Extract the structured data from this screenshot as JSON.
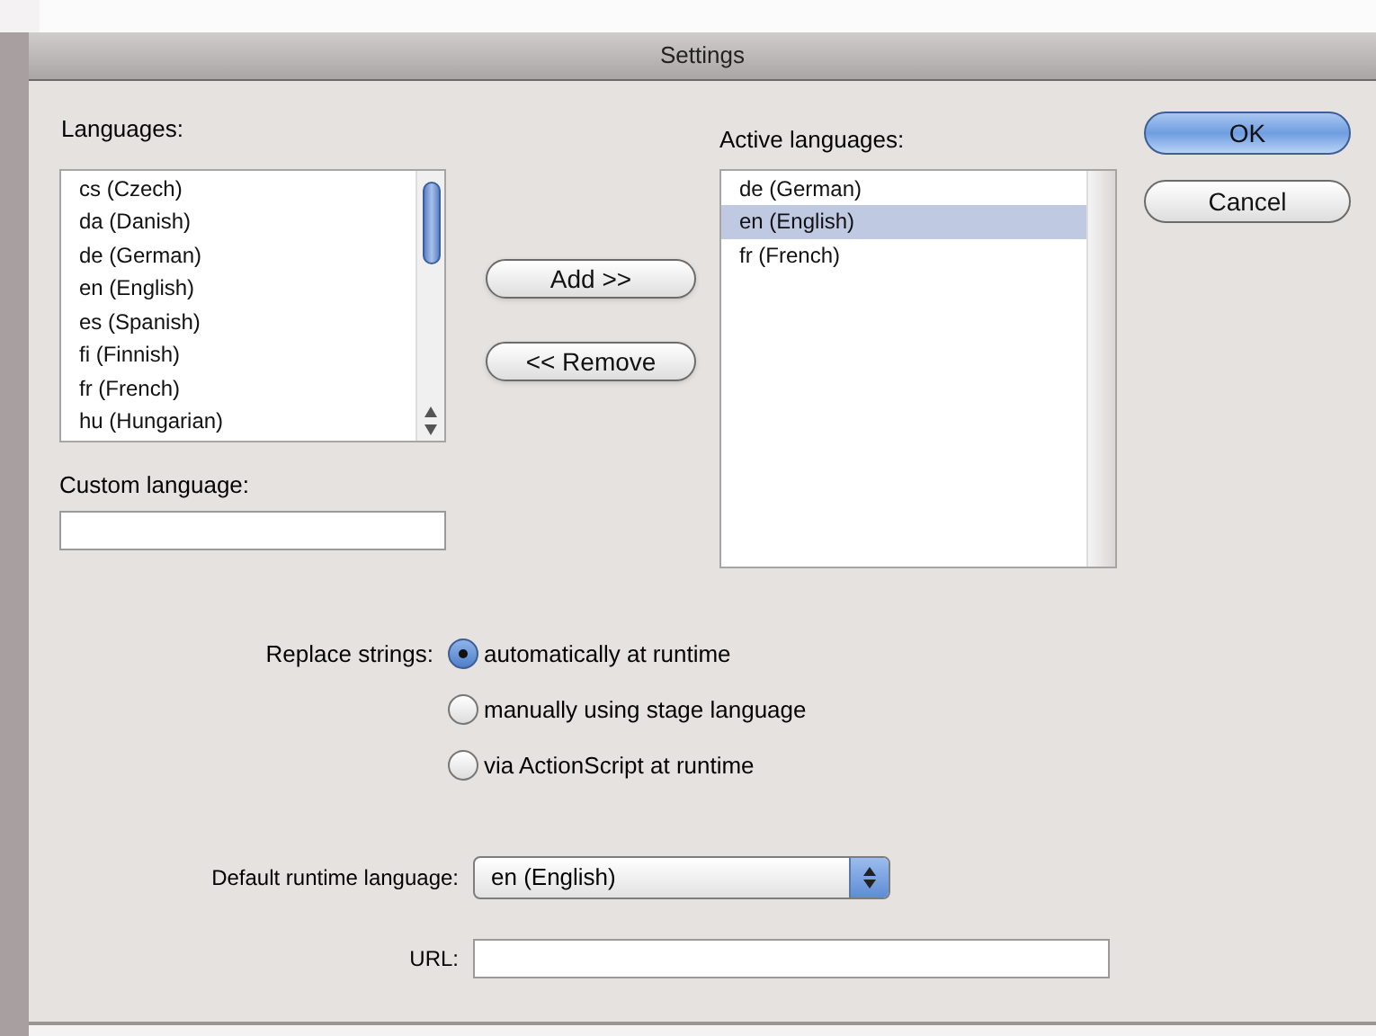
{
  "window": {
    "title": "Settings"
  },
  "languages": {
    "label": "Languages:",
    "items": [
      {
        "text": "cs (Czech)",
        "selected": false
      },
      {
        "text": "da (Danish)",
        "selected": false
      },
      {
        "text": "de (German)",
        "selected": false
      },
      {
        "text": "en (English)",
        "selected": false
      },
      {
        "text": "es (Spanish)",
        "selected": false
      },
      {
        "text": "fi (Finnish)",
        "selected": false
      },
      {
        "text": "fr (French)",
        "selected": false
      },
      {
        "text": "hu (Hungarian)",
        "selected": false
      }
    ]
  },
  "custom_language": {
    "label": "Custom language:"
  },
  "transfer_buttons": [
    "Add >>",
    "<< Remove"
  ],
  "active_languages": {
    "label": "Active languages:",
    "items": [
      {
        "text": "de (German)",
        "selected": false
      },
      {
        "text": "en (English)",
        "selected": true
      },
      {
        "text": "fr (French)",
        "selected": false
      }
    ]
  },
  "dialog_buttons": [
    {
      "label": "OK",
      "default": true
    },
    {
      "label": "Cancel",
      "default": false
    }
  ],
  "replace_strings": {
    "label": "Replace strings:",
    "options": [
      {
        "label": "automatically at runtime",
        "selected": true
      },
      {
        "label": "manually using stage language",
        "selected": false
      },
      {
        "label": "via ActionScript at runtime",
        "selected": false
      }
    ]
  },
  "default_runtime_language": {
    "label": "Default runtime language:",
    "value": "en (English)"
  },
  "url": {
    "label": "URL:"
  }
}
